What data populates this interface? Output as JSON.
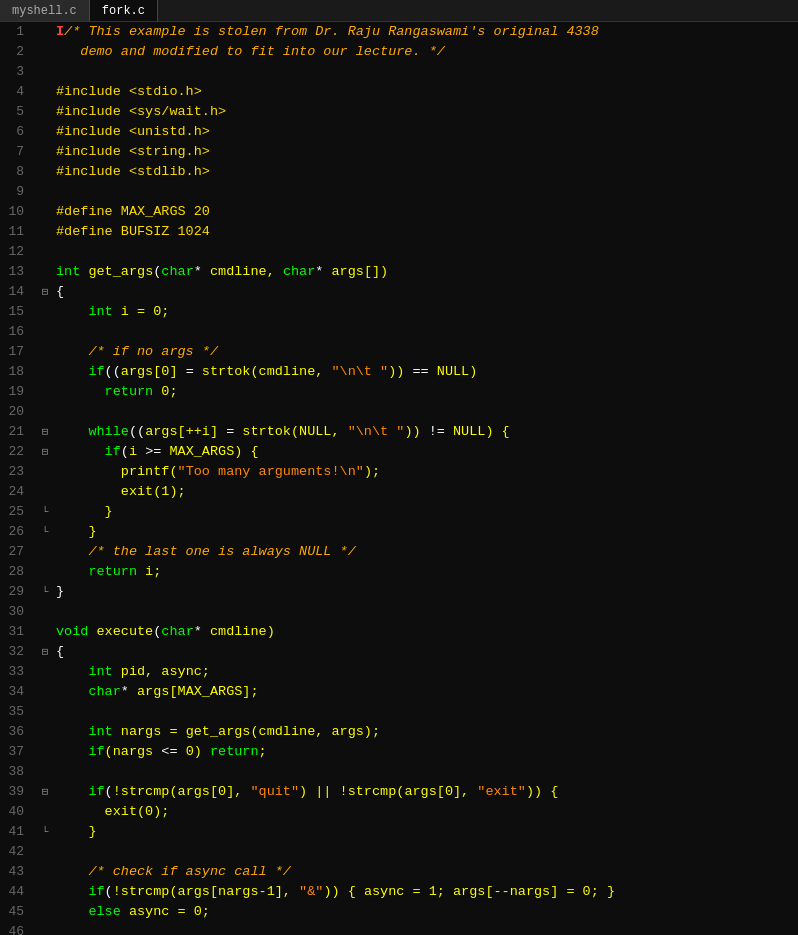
{
  "tabs": [
    {
      "label": "myshell.c",
      "active": false
    },
    {
      "label": "fork.c",
      "active": true
    }
  ],
  "lines": [
    {
      "num": 1,
      "fold": "",
      "content": [
        {
          "t": "cm",
          "v": "/* This example is stolen from Dr. Raju Rangaswami's original 4338"
        }
      ],
      "mark": true
    },
    {
      "num": 2,
      "fold": "",
      "content": [
        {
          "t": "cm",
          "v": "   demo and modified to fit into our lecture. */"
        }
      ]
    },
    {
      "num": 3,
      "fold": "",
      "content": []
    },
    {
      "num": 4,
      "fold": "",
      "content": [
        {
          "t": "pp",
          "v": "#include <stdio.h>"
        }
      ]
    },
    {
      "num": 5,
      "fold": "",
      "content": [
        {
          "t": "pp",
          "v": "#include <sys/wait.h>"
        }
      ]
    },
    {
      "num": 6,
      "fold": "",
      "content": [
        {
          "t": "pp",
          "v": "#include <unistd.h>"
        }
      ]
    },
    {
      "num": 7,
      "fold": "",
      "content": [
        {
          "t": "pp",
          "v": "#include <string.h>"
        }
      ]
    },
    {
      "num": 8,
      "fold": "",
      "content": [
        {
          "t": "pp",
          "v": "#include <stdlib.h>"
        }
      ]
    },
    {
      "num": 9,
      "fold": "",
      "content": []
    },
    {
      "num": 10,
      "fold": "",
      "content": [
        {
          "t": "pp",
          "v": "#define MAX_ARGS 20"
        }
      ]
    },
    {
      "num": 11,
      "fold": "",
      "content": [
        {
          "t": "pp",
          "v": "#define BUFSIZ 1024"
        }
      ]
    },
    {
      "num": 12,
      "fold": "",
      "content": []
    },
    {
      "num": 13,
      "fold": "",
      "content": [
        {
          "t": "kw",
          "v": "int"
        },
        {
          "t": "pl",
          "v": " "
        },
        {
          "t": "fn",
          "v": "get_args"
        },
        {
          "t": "punc",
          "v": "("
        },
        {
          "t": "kw",
          "v": "char"
        },
        {
          "t": "op",
          "v": "*"
        },
        {
          "t": "pl",
          "v": " cmdline, "
        },
        {
          "t": "kw",
          "v": "char"
        },
        {
          "t": "op",
          "v": "*"
        },
        {
          "t": "pl",
          "v": " args[])"
        }
      ]
    },
    {
      "num": 14,
      "fold": "open",
      "content": [
        {
          "t": "punc",
          "v": "{"
        }
      ]
    },
    {
      "num": 15,
      "fold": "",
      "content": [
        {
          "t": "pl",
          "v": "    "
        },
        {
          "t": "kw",
          "v": "int"
        },
        {
          "t": "pl",
          "v": " i = 0;"
        }
      ]
    },
    {
      "num": 16,
      "fold": "",
      "content": []
    },
    {
      "num": 17,
      "fold": "",
      "content": [
        {
          "t": "pl",
          "v": "    "
        },
        {
          "t": "cm",
          "v": "/* if no args */"
        }
      ]
    },
    {
      "num": 18,
      "fold": "",
      "content": [
        {
          "t": "pl",
          "v": "    "
        },
        {
          "t": "kw",
          "v": "if"
        },
        {
          "t": "punc",
          "v": "(("
        },
        {
          "t": "pl",
          "v": "args[0] "
        },
        {
          "t": "op",
          "v": "="
        },
        {
          "t": "pl",
          "v": " strtok(cmdline, "
        },
        {
          "t": "str",
          "v": "\"\\n\\t \""
        },
        {
          "t": "pl",
          "v": ")) "
        },
        {
          "t": "op",
          "v": "=="
        },
        {
          "t": "pl",
          "v": " NULL)"
        }
      ]
    },
    {
      "num": 19,
      "fold": "",
      "content": [
        {
          "t": "pl",
          "v": "      "
        },
        {
          "t": "kw",
          "v": "return"
        },
        {
          "t": "pl",
          "v": " 0;"
        }
      ]
    },
    {
      "num": 20,
      "fold": "",
      "content": []
    },
    {
      "num": 21,
      "fold": "open",
      "content": [
        {
          "t": "pl",
          "v": "    "
        },
        {
          "t": "kw",
          "v": "while"
        },
        {
          "t": "punc",
          "v": "(("
        },
        {
          "t": "pl",
          "v": "args[++i] "
        },
        {
          "t": "op",
          "v": "="
        },
        {
          "t": "pl",
          "v": " strtok(NULL, "
        },
        {
          "t": "str",
          "v": "\"\\n\\t \""
        },
        {
          "t": "pl",
          "v": ")) "
        },
        {
          "t": "op",
          "v": "!="
        },
        {
          "t": "pl",
          "v": " NULL) {"
        }
      ]
    },
    {
      "num": 22,
      "fold": "open",
      "content": [
        {
          "t": "pl",
          "v": "      "
        },
        {
          "t": "kw",
          "v": "if"
        },
        {
          "t": "punc",
          "v": "("
        },
        {
          "t": "pl",
          "v": "i "
        },
        {
          "t": "op",
          "v": ">="
        },
        {
          "t": "pl",
          "v": " MAX_ARGS) {"
        }
      ]
    },
    {
      "num": 23,
      "fold": "",
      "content": [
        {
          "t": "pl",
          "v": "        printf("
        },
        {
          "t": "str",
          "v": "\"Too many arguments!\\n\""
        },
        {
          "t": "pl",
          "v": ");"
        }
      ]
    },
    {
      "num": 24,
      "fold": "",
      "content": [
        {
          "t": "pl",
          "v": "        exit(1);"
        }
      ]
    },
    {
      "num": 25,
      "fold": "close",
      "content": [
        {
          "t": "pl",
          "v": "      }"
        }
      ]
    },
    {
      "num": 26,
      "fold": "close",
      "content": [
        {
          "t": "pl",
          "v": "    }"
        }
      ]
    },
    {
      "num": 27,
      "fold": "",
      "content": [
        {
          "t": "pl",
          "v": "    "
        },
        {
          "t": "cm",
          "v": "/* the last one is always NULL */"
        }
      ]
    },
    {
      "num": 28,
      "fold": "",
      "content": [
        {
          "t": "pl",
          "v": "    "
        },
        {
          "t": "kw",
          "v": "return"
        },
        {
          "t": "pl",
          "v": " i;"
        }
      ]
    },
    {
      "num": 29,
      "fold": "close",
      "content": [
        {
          "t": "punc",
          "v": "}"
        }
      ]
    },
    {
      "num": 30,
      "fold": "",
      "content": []
    },
    {
      "num": 31,
      "fold": "",
      "content": [
        {
          "t": "kw",
          "v": "void"
        },
        {
          "t": "pl",
          "v": " "
        },
        {
          "t": "fn",
          "v": "execute"
        },
        {
          "t": "punc",
          "v": "("
        },
        {
          "t": "kw",
          "v": "char"
        },
        {
          "t": "op",
          "v": "*"
        },
        {
          "t": "pl",
          "v": " cmdline)"
        }
      ]
    },
    {
      "num": 32,
      "fold": "open",
      "content": [
        {
          "t": "punc",
          "v": "{"
        }
      ]
    },
    {
      "num": 33,
      "fold": "",
      "content": [
        {
          "t": "pl",
          "v": "    "
        },
        {
          "t": "kw",
          "v": "int"
        },
        {
          "t": "pl",
          "v": " pid, async;"
        }
      ]
    },
    {
      "num": 34,
      "fold": "",
      "content": [
        {
          "t": "pl",
          "v": "    "
        },
        {
          "t": "kw",
          "v": "char"
        },
        {
          "t": "op",
          "v": "*"
        },
        {
          "t": "pl",
          "v": " args[MAX_ARGS];"
        }
      ]
    },
    {
      "num": 35,
      "fold": "",
      "content": []
    },
    {
      "num": 36,
      "fold": "",
      "content": [
        {
          "t": "pl",
          "v": "    "
        },
        {
          "t": "kw",
          "v": "int"
        },
        {
          "t": "pl",
          "v": " nargs = get_args(cmdline, args);"
        }
      ]
    },
    {
      "num": 37,
      "fold": "",
      "content": [
        {
          "t": "pl",
          "v": "    "
        },
        {
          "t": "kw",
          "v": "if"
        },
        {
          "t": "pl",
          "v": "(nargs "
        },
        {
          "t": "op",
          "v": "<="
        },
        {
          "t": "pl",
          "v": " 0) "
        },
        {
          "t": "kw",
          "v": "return"
        },
        {
          "t": "pl",
          "v": ";"
        }
      ]
    },
    {
      "num": 38,
      "fold": "",
      "content": []
    },
    {
      "num": 39,
      "fold": "open",
      "content": [
        {
          "t": "pl",
          "v": "    "
        },
        {
          "t": "kw",
          "v": "if"
        },
        {
          "t": "punc",
          "v": "("
        },
        {
          "t": "pl",
          "v": "!strcmp(args[0], "
        },
        {
          "t": "str",
          "v": "\"quit\""
        },
        {
          "t": "pl",
          "v": ") || !strcmp(args[0], "
        },
        {
          "t": "str",
          "v": "\"exit\""
        },
        {
          "t": "pl",
          "v": ")) {"
        }
      ]
    },
    {
      "num": 40,
      "fold": "",
      "content": [
        {
          "t": "pl",
          "v": "      exit(0);"
        }
      ]
    },
    {
      "num": 41,
      "fold": "close",
      "content": [
        {
          "t": "pl",
          "v": "    }"
        }
      ]
    },
    {
      "num": 42,
      "fold": "",
      "content": []
    },
    {
      "num": 43,
      "fold": "",
      "content": [
        {
          "t": "pl",
          "v": "    "
        },
        {
          "t": "cm",
          "v": "/* check if async call */"
        }
      ]
    },
    {
      "num": 44,
      "fold": "",
      "content": [
        {
          "t": "pl",
          "v": "    "
        },
        {
          "t": "kw",
          "v": "if"
        },
        {
          "t": "punc",
          "v": "("
        },
        {
          "t": "pl",
          "v": "!strcmp(args[nargs-1], "
        },
        {
          "t": "str",
          "v": "\"&\""
        },
        {
          "t": "pl",
          "v": ")) { async = 1; args[--nargs] = 0; }"
        }
      ]
    },
    {
      "num": 45,
      "fold": "",
      "content": [
        {
          "t": "pl",
          "v": "    "
        },
        {
          "t": "kw",
          "v": "else"
        },
        {
          "t": "pl",
          "v": " async = 0;"
        }
      ]
    },
    {
      "num": 46,
      "fold": "",
      "content": []
    }
  ]
}
